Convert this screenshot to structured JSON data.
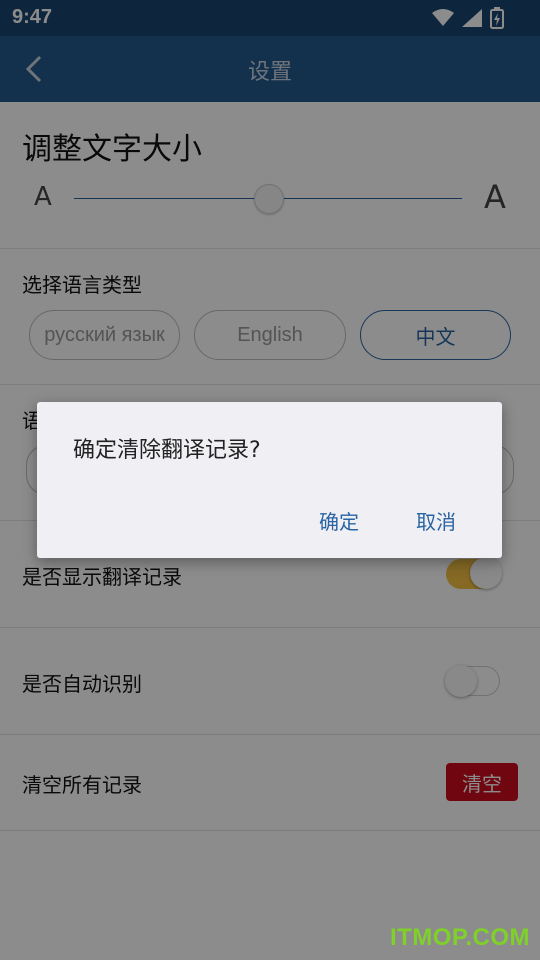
{
  "status_bar": {
    "time": "9:47",
    "icons": [
      "wifi-icon",
      "signal-icon",
      "battery-charging-icon"
    ]
  },
  "app_bar": {
    "title": "设置",
    "back_icon": "chevron-left-icon"
  },
  "font_size": {
    "title": "调整文字大小",
    "small_label": "A",
    "large_label": "A",
    "slider_value": 0.5
  },
  "language": {
    "label": "选择语言类型",
    "options": [
      {
        "label": "русский язык",
        "selected": false
      },
      {
        "label": "English",
        "selected": false
      },
      {
        "label": "中文",
        "selected": true
      }
    ]
  },
  "hidden_section": {
    "label_fragment": "语"
  },
  "settings": {
    "show_history": {
      "label": "是否显示翻译记录",
      "enabled": true
    },
    "auto_detect": {
      "label": "是否自动识别",
      "enabled": false
    },
    "clear_all": {
      "label": "清空所有记录",
      "button": "清空"
    }
  },
  "dialog": {
    "message": "确定清除翻译记录?",
    "confirm": "确定",
    "cancel": "取消"
  },
  "watermark": "ITMOP.COM",
  "colors": {
    "status_bar": "#1b4472",
    "app_bar": "#24588d",
    "accent": "#2a64a2",
    "toggle_on": "#f2c044",
    "danger": "#cc0d1e"
  }
}
